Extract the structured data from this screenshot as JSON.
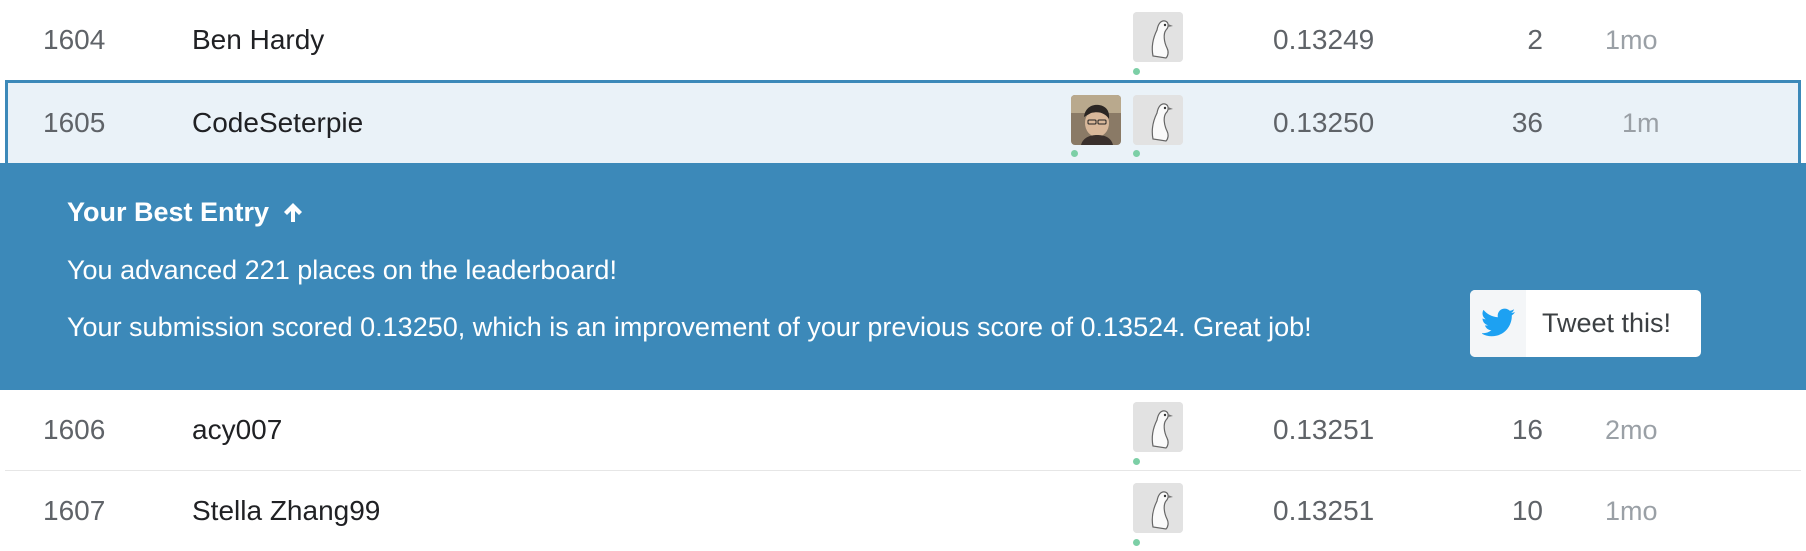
{
  "rows_above": [
    {
      "rank": "1604",
      "name": "Ben Hardy",
      "score": "0.13249",
      "entries": "2",
      "last": "1mo"
    }
  ],
  "current_row": {
    "rank": "1605",
    "name": "CodeSeterpie",
    "score": "0.13250",
    "entries": "36",
    "last": "1m"
  },
  "banner": {
    "title": "Your Best Entry",
    "line1": "You advanced 221 places on the leaderboard!",
    "line2": "Your submission scored 0.13250, which is an improvement of your previous score of 0.13524. Great job!",
    "tweet_label": "Tweet this!",
    "tweet_icon": "twitter-bird-icon"
  },
  "rows_below": [
    {
      "rank": "1606",
      "name": "acy007",
      "score": "0.13251",
      "entries": "16",
      "last": "2mo"
    },
    {
      "rank": "1607",
      "name": "Stella Zhang99",
      "score": "0.13251",
      "entries": "10",
      "last": "1mo"
    }
  ],
  "colors": {
    "banner": "#3c89b9",
    "highlight_row": "#eaf2f8",
    "online_dot": "#7ccfa6",
    "twitter": "#1da1f2"
  }
}
